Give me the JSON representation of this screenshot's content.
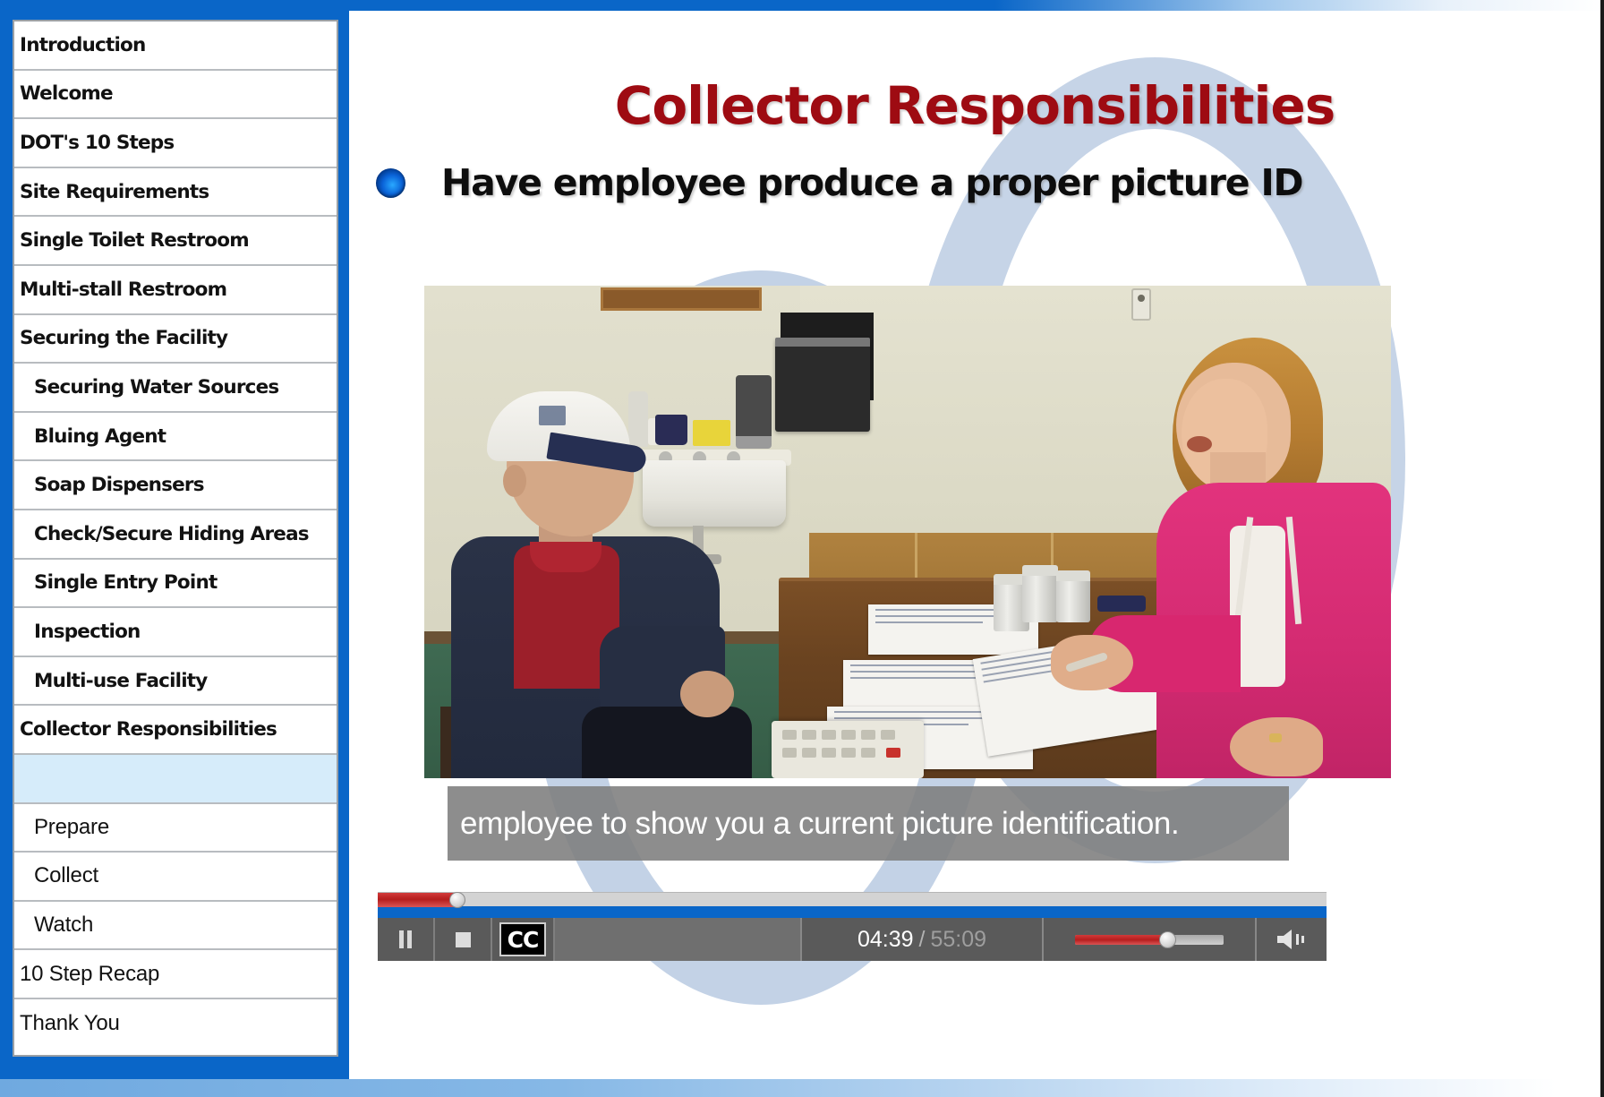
{
  "theme": {
    "frame_blue": "#0a66c8",
    "title_red": "#9e0b12",
    "watermark_blue": "#c3d2e6",
    "active_item_blue": "#d6ecfa",
    "player_gray": "#5a5a5a",
    "progress_red": "#b71e1e",
    "caption_bg": "#7d7d7d"
  },
  "sidebar": {
    "items": [
      {
        "label": "Introduction",
        "indent": 0,
        "weight": "heavy",
        "active": false
      },
      {
        "label": "Welcome",
        "indent": 0,
        "weight": "heavy",
        "active": false
      },
      {
        "label": "DOT's 10 Steps",
        "indent": 0,
        "weight": "heavy",
        "active": false
      },
      {
        "label": "Site Requirements",
        "indent": 0,
        "weight": "heavy",
        "active": false
      },
      {
        "label": "Single Toilet Restroom",
        "indent": 0,
        "weight": "heavy",
        "active": false
      },
      {
        "label": "Multi-stall Restroom",
        "indent": 0,
        "weight": "heavy",
        "active": false
      },
      {
        "label": "Securing the Facility",
        "indent": 0,
        "weight": "heavy",
        "active": false
      },
      {
        "label": "Securing Water Sources",
        "indent": 1,
        "weight": "heavy",
        "active": false
      },
      {
        "label": "Bluing Agent",
        "indent": 1,
        "weight": "heavy",
        "active": false
      },
      {
        "label": "Soap Dispensers",
        "indent": 1,
        "weight": "heavy",
        "active": false
      },
      {
        "label": "Check/Secure Hiding Areas",
        "indent": 1,
        "weight": "heavy",
        "active": false
      },
      {
        "label": "Single Entry Point",
        "indent": 1,
        "weight": "heavy",
        "active": false
      },
      {
        "label": "Inspection",
        "indent": 1,
        "weight": "heavy",
        "active": false
      },
      {
        "label": "Multi-use Facility",
        "indent": 1,
        "weight": "heavy",
        "active": false
      },
      {
        "label": "Collector Responsibilities",
        "indent": 0,
        "weight": "heavy",
        "active": false
      },
      {
        "label": "",
        "indent": 0,
        "weight": "light",
        "active": true
      },
      {
        "label": "Prepare",
        "indent": 1,
        "weight": "light",
        "active": false
      },
      {
        "label": "Collect",
        "indent": 1,
        "weight": "light",
        "active": false
      },
      {
        "label": "Watch",
        "indent": 1,
        "weight": "light",
        "active": false
      },
      {
        "label": "10 Step Recap",
        "indent": 0,
        "weight": "light",
        "active": false
      },
      {
        "label": "Thank You",
        "indent": 0,
        "weight": "light",
        "active": false
      }
    ]
  },
  "slide": {
    "title": "Collector Responsibilities",
    "bullet": "Have employee produce a proper picture ID"
  },
  "video": {
    "caption": "employee to show you a current picture identification."
  },
  "player": {
    "pause_label": "Pause",
    "stop_label": "Stop",
    "cc_label": "CC",
    "current_time": "04:39",
    "time_separator": "/",
    "total_time": "55:09",
    "progress_percent": 8.4,
    "volume_percent": 62,
    "speaker_icon": "speaker-icon"
  }
}
